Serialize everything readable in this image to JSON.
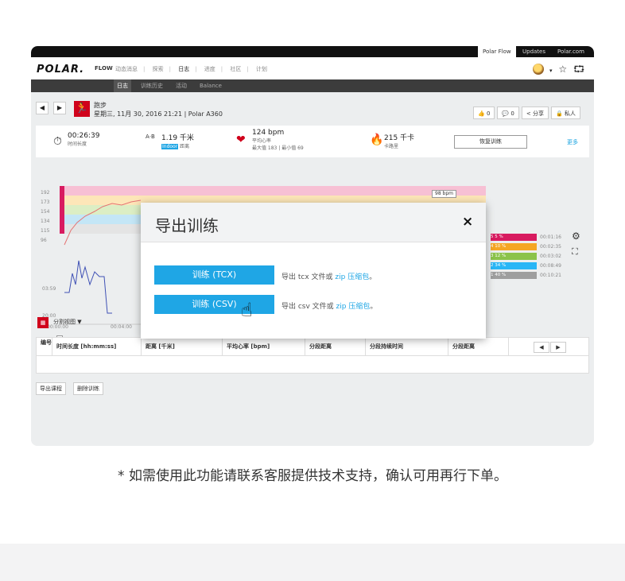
{
  "topbar": {
    "links": [
      "Polar Flow",
      "Updates",
      "Polar.com"
    ]
  },
  "navbar": {
    "logo": "POLAR.",
    "flow": "FLOW",
    "items": [
      "动态消息",
      "探索",
      "日志",
      "进度",
      "社区",
      "计划"
    ],
    "icons": [
      "avatar",
      "chevron-down-icon",
      "star-icon",
      "sync-icon"
    ]
  },
  "subnav": {
    "items": [
      "日志",
      "训练历史",
      "活动",
      "Balance"
    ]
  },
  "session": {
    "sport": "跑步",
    "date": "星期三, 11月 30, 2016 21:21 | Polar A360",
    "like_count": "0",
    "comment_count": "0",
    "share_label": "分享",
    "privacy_label": "私人"
  },
  "stats": {
    "duration_value": "00:26:39",
    "duration_label": "时间长度",
    "distance_value": "1.19 千米",
    "distance_label": "距离",
    "distance_badge": "Indoor",
    "hr_value": "124 bpm",
    "hr_label": "平均心率",
    "hr_range": "最大值 183 | 最小值 69",
    "calories_value": "215 千卡",
    "calories_label": "卡路里",
    "resume_button": "恢复训练",
    "more_link": "更多"
  },
  "chart": {
    "hr_ticks": [
      "192",
      "173",
      "154",
      "134",
      "115",
      "96"
    ],
    "pace_ticks": [
      "03:59",
      "20:00"
    ],
    "time_ticks": [
      "00:00:00",
      "00:04:00"
    ],
    "hover_value": "98 bpm",
    "zones": [
      {
        "num": "5",
        "pct": "5 %",
        "time": "00:01:16",
        "color": "#d81b60"
      },
      {
        "num": "4",
        "pct": "10 %",
        "time": "00:02:35",
        "color": "#f5a623"
      },
      {
        "num": "3",
        "pct": "12 %",
        "time": "00:03:02",
        "color": "#8bc34a"
      },
      {
        "num": "2",
        "pct": "34 %",
        "time": "00:08:49",
        "color": "#29b6f6"
      },
      {
        "num": "1",
        "pct": "40 %",
        "time": "00:10:21",
        "color": "#9e9e9e"
      }
    ]
  },
  "table": {
    "dropdown": "分割视图",
    "columns": [
      "编号",
      "时间长度 [hh:mm:ss]",
      "距离 [千米]",
      "平均心率 [bpm]",
      "分段距离",
      "分段持续时间",
      "分段距离"
    ]
  },
  "actions": {
    "export": "导出课程",
    "delete": "删除训练"
  },
  "modal": {
    "title": "导出训练",
    "close": "×",
    "tcx_button": "训练 (TCX)",
    "tcx_desc_pre": "导出 tcx 文件或 ",
    "tcx_desc_zip": "zip 压缩包",
    "tcx_desc_post": "。",
    "csv_button": "训练 (CSV)",
    "csv_desc_pre": "导出 csv 文件或 ",
    "csv_desc_zip": "zip 压缩包",
    "csv_desc_post": "。"
  },
  "note": "* 如需使用此功能请联系客服提供技术支持，确认可用再行下单。"
}
